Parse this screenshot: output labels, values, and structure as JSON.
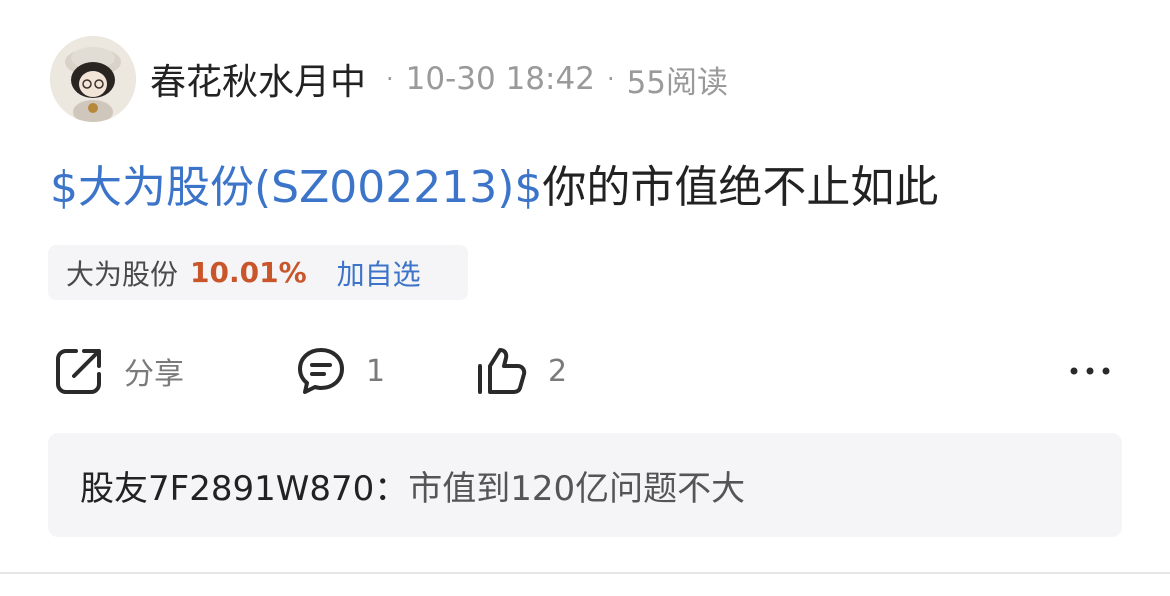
{
  "post": {
    "author": "春花秋水月中",
    "date": "10-30 18:42",
    "reads": "55阅读",
    "title": {
      "stock_link": "$大为股份(SZ002213)$",
      "text": "你的市值绝不止如此"
    }
  },
  "stock_chip": {
    "name": "大为股份",
    "change": "10.01%",
    "add_label": "加自选"
  },
  "actions": {
    "share_label": "分享",
    "comment_count": "1",
    "like_count": "2"
  },
  "comment": {
    "user": "股友7F2891W870：",
    "text": "市值到120亿问题不大"
  },
  "icons": {
    "share": "share-icon",
    "comment": "comment-icon",
    "like": "thumbs-up-icon",
    "more": "more-icon"
  },
  "colors": {
    "link_blue": "#3b74c9",
    "change_red": "#c9552a",
    "muted_gray": "#9a9a9a",
    "chip_bg": "#f5f5f7"
  }
}
